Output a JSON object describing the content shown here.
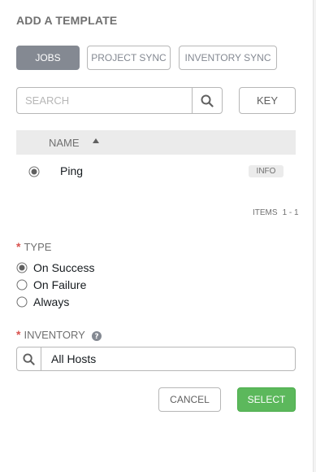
{
  "title": "ADD A TEMPLATE",
  "tabs": [
    {
      "label": "JOBS"
    },
    {
      "label": "PROJECT SYNC"
    },
    {
      "label": "INVENTORY SYNC"
    }
  ],
  "search": {
    "placeholder": "SEARCH"
  },
  "key_label": "KEY",
  "table": {
    "column_name": "NAME",
    "rows": [
      {
        "name": "Ping",
        "badge": "INFO",
        "selected": true
      }
    ],
    "items_label": "ITEMS",
    "items_range": "1 - 1"
  },
  "type": {
    "required_mark": "*",
    "label": "TYPE",
    "options": [
      {
        "label": "On Success",
        "checked": true
      },
      {
        "label": "On Failure",
        "checked": false
      },
      {
        "label": "Always",
        "checked": false
      }
    ]
  },
  "inventory": {
    "required_mark": "*",
    "label": "INVENTORY",
    "value": "All Hosts"
  },
  "buttons": {
    "cancel": "CANCEL",
    "select": "SELECT"
  },
  "colors": {
    "accent": "#5cb85c",
    "tab_active": "#848992",
    "required": "#d9534f"
  }
}
